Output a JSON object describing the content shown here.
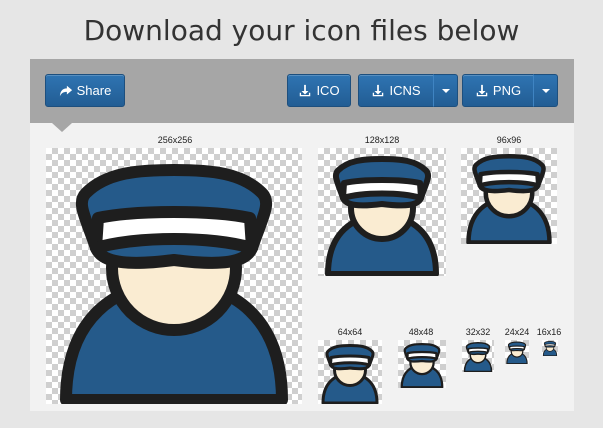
{
  "page": {
    "title": "Download your icon files below"
  },
  "toolbar": {
    "share_label": "Share",
    "ico_label": "ICO",
    "icns_label": "ICNS",
    "png_label": "PNG"
  },
  "icon": {
    "name": "police-officer-icon",
    "colors": {
      "uniform": "#255a8a",
      "face": "#faecd2",
      "band": "#ffffff",
      "outline": "#1e1e1e"
    }
  },
  "sizes": [
    "256x256",
    "128x128",
    "96x96",
    "64x64",
    "48x48",
    "32x32",
    "24x24",
    "16x16"
  ],
  "colors": {
    "button": "#2a6aa6",
    "toolbar": "#a6a6a6",
    "panel": "#f2f2f2",
    "background": "#e6e6e6"
  }
}
